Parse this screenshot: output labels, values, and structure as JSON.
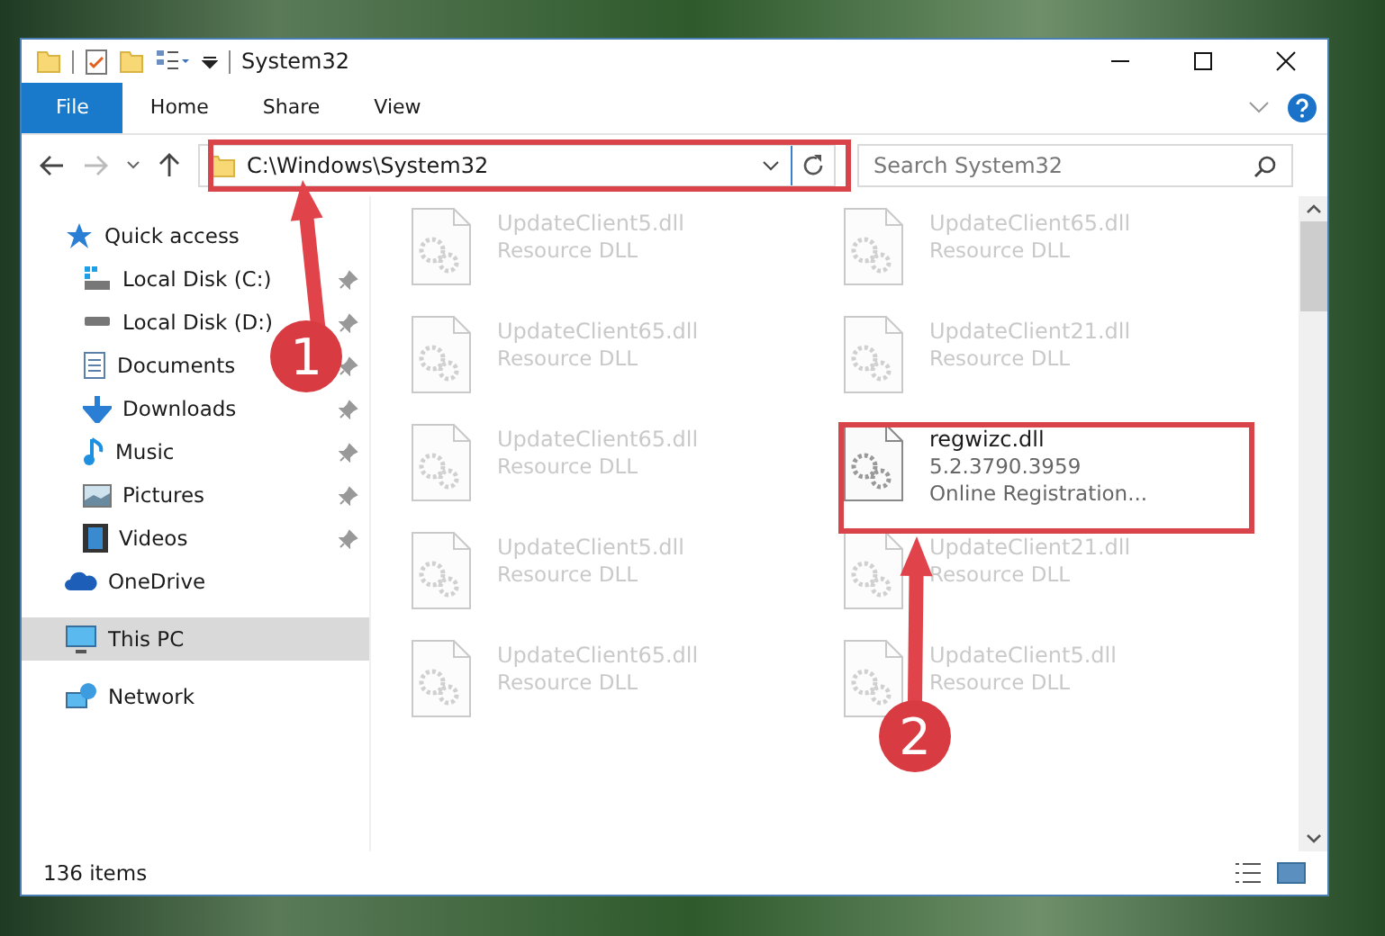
{
  "window": {
    "title": "System32"
  },
  "ribbon_tabs": [
    {
      "label": "File",
      "kind": "file"
    },
    {
      "label": "Home",
      "kind": "tab"
    },
    {
      "label": "Share",
      "kind": "tab"
    },
    {
      "label": "View",
      "kind": "tab"
    }
  ],
  "address_bar": {
    "path": "C:\\Windows\\System32"
  },
  "search": {
    "placeholder": "Search System32"
  },
  "sidebar": {
    "items": [
      {
        "label": "Quick access",
        "kind": "star",
        "selected": false,
        "children": [
          {
            "label": "Local Disk (C:)",
            "kind": "drive-c",
            "pinned": true
          },
          {
            "label": "Local Disk (D:)",
            "kind": "drive",
            "pinned": true
          },
          {
            "label": "Documents",
            "kind": "documents",
            "pinned": true
          },
          {
            "label": "Downloads",
            "kind": "downloads",
            "pinned": true
          },
          {
            "label": "Music",
            "kind": "music",
            "pinned": true
          },
          {
            "label": "Pictures",
            "kind": "pictures",
            "pinned": true
          },
          {
            "label": "Videos",
            "kind": "videos",
            "pinned": true
          }
        ]
      },
      {
        "label": "OneDrive",
        "kind": "cloud",
        "selected": false
      },
      {
        "label": "This PC",
        "kind": "pc",
        "selected": true
      },
      {
        "label": "Network",
        "kind": "network",
        "selected": false
      }
    ]
  },
  "files": [
    {
      "name": "UpdateClient5.dll",
      "details": [
        "Resource DLL"
      ],
      "blurred": true
    },
    {
      "name": "UpdateClient65.dll",
      "details": [
        "Resource DLL"
      ],
      "blurred": true
    },
    {
      "name": "UpdateClient65.dll",
      "details": [
        "Resource DLL"
      ],
      "blurred": true
    },
    {
      "name": "UpdateClient21.dll",
      "details": [
        "Resource DLL"
      ],
      "blurred": true
    },
    {
      "name": "UpdateClient65.dll",
      "details": [
        "Resource DLL"
      ],
      "blurred": true
    },
    {
      "name": "regwizc.dll",
      "details": [
        "5.2.3790.3959",
        "Online Registration..."
      ],
      "blurred": false
    },
    {
      "name": "UpdateClient5.dll",
      "details": [
        "Resource DLL"
      ],
      "blurred": true
    },
    {
      "name": "UpdateClient21.dll",
      "details": [
        "Resource DLL"
      ],
      "blurred": true
    },
    {
      "name": "UpdateClient65.dll",
      "details": [
        "Resource DLL"
      ],
      "blurred": true
    },
    {
      "name": "UpdateClient5.dll",
      "details": [
        "Resource DLL"
      ],
      "blurred": true
    }
  ],
  "status_bar": {
    "item_count": "136 items"
  },
  "annotations": [
    {
      "label": "1"
    },
    {
      "label": "2"
    }
  ]
}
